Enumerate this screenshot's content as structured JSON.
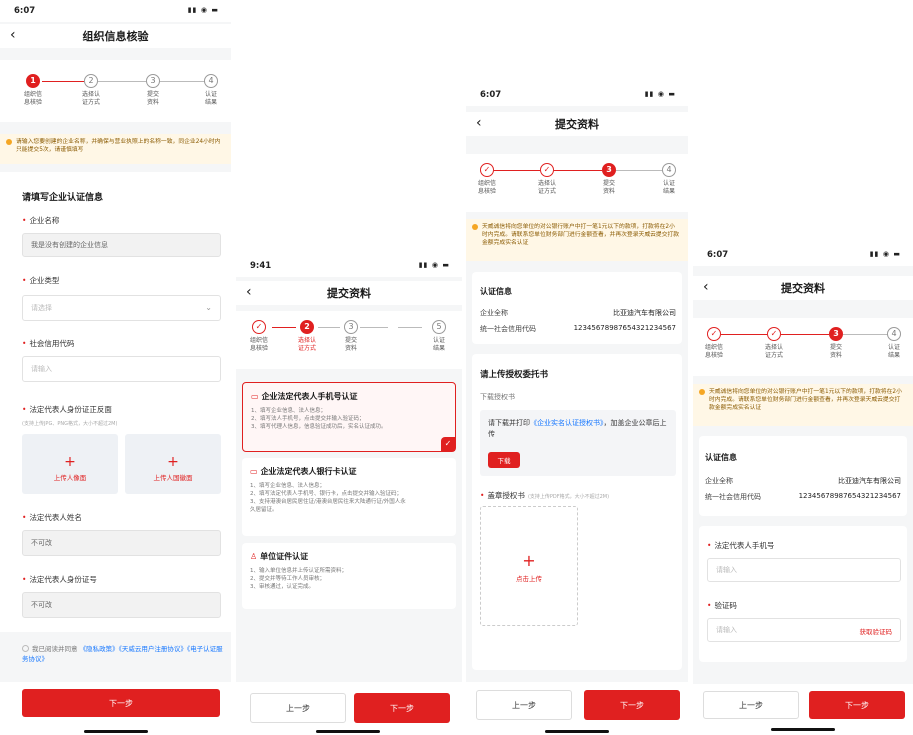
{
  "colors": {
    "accent": "#e02020",
    "notice_bg": "#fff7e6"
  },
  "screen1": {
    "status_time": "6:07",
    "title": "组织信息核验",
    "steps": [
      {
        "num": "1",
        "label1": "组织信",
        "label2": "息核验"
      },
      {
        "num": "2",
        "label1": "选择认",
        "label2": "证方式"
      },
      {
        "num": "3",
        "label1": "提交",
        "label2": "资料"
      },
      {
        "num": "4",
        "label1": "认证",
        "label2": "结果"
      }
    ],
    "notice": "请输入您要创建的企业名称，并确保与营业执照上的名称一致，同企业24小时内只能提交5次，请谨慎填写",
    "section_title": "请填写企业认证信息",
    "company_name_label": "企业名称",
    "company_name_value": "我是没有创建的企业信息",
    "company_type_label": "企业类型",
    "company_type_placeholder": "请选择",
    "credit_code_label": "社会信用代码",
    "credit_code_placeholder": "请输入",
    "id_card_label": "法定代表人身份证正反面",
    "id_card_hint": "(支持上传JPG、PNG格式，大小不超过2M)",
    "upload_front": "上传人像面",
    "upload_back": "上传人国徽面",
    "legal_name_label": "法定代表人姓名",
    "legal_name_value": "不可改",
    "legal_id_label": "法定代表人身份证号",
    "legal_id_value": "不可改",
    "agree_prefix": "我已阅读并同意",
    "agree_privacy": "《隐私政策》",
    "agree_terms": "《天威云用户注册协议》",
    "agree_esign": "《电子认证服务协议》",
    "next": "下一步"
  },
  "screen2": {
    "status_time": "9:41",
    "title": "提交资料",
    "steps": [
      {
        "num": "✓",
        "label1": "组织信",
        "label2": "息核验"
      },
      {
        "num": "2",
        "label1": "选择认",
        "label2": "证方式"
      },
      {
        "num": "3",
        "label1": "提交",
        "label2": "资料"
      },
      {
        "num": "5",
        "label1": "认证",
        "label2": "结果"
      }
    ],
    "opt1_title": "企业法定代表人手机号认证",
    "opt1_desc": [
      "1、填写企业信息、法人信息；",
      "2、填写法人手机号，点击提交并输入验证码；",
      "3、填写代理人信息，信息验证成功后，实名认证成功。"
    ],
    "opt2_title": "企业法定代表人银行卡认证",
    "opt2_desc": [
      "1、填写企业信息、法人信息；",
      "2、填写法定代表人手机号、银行卡，点击提交并输入验证码；",
      "3、支持港澳台居民居住证/港澳台居民往来大陆通行证/外国人永",
      "久居留证。"
    ],
    "opt3_title": "单位证件认证",
    "opt3_desc": [
      "1、输入单位信息并上传认证所需资料；",
      "2、提交并等待工作人员审核；",
      "3、审核通过，认证完成。"
    ],
    "prev": "上一步",
    "next": "下一步"
  },
  "screen3": {
    "status_time": "6:07",
    "title": "提交资料",
    "steps": [
      {
        "num": "✓",
        "label1": "组织信",
        "label2": "息核验"
      },
      {
        "num": "✓",
        "label1": "选择认",
        "label2": "证方式"
      },
      {
        "num": "3",
        "label1": "提交",
        "label2": "资料"
      },
      {
        "num": "4",
        "label1": "认证",
        "label2": "结果"
      }
    ],
    "notice": "天威诚信将向您单位的对公银行账户中打一笔1元以下的款项，打款将在2小时内完成。请联系您单位财务部门进行金额查看，并再次登录天威云提交打款金额完成实名认证",
    "info_title": "认证信息",
    "company_label": "企业全称",
    "company_value": "比亚迪汽车有限公司",
    "code_label": "统一社会信用代码",
    "code_value": "12345678987654321234567",
    "auth_title": "请上传授权委托书",
    "download_label": "下载授权书",
    "download_text1": "请下载并打印",
    "download_link": "《企业实名认证授权书》",
    "download_text2": "，加盖企业公章后上传",
    "download_btn": "下载",
    "stamp_label": "盖章授权书",
    "stamp_hint": "(支持上传PDF格式，大小不超过2M)",
    "upload_text": "点击上传",
    "prev": "上一步",
    "next": "下一步"
  },
  "screen4": {
    "status_time": "6:07",
    "title": "提交资料",
    "steps": [
      {
        "num": "✓",
        "label1": "组织信",
        "label2": "息核验"
      },
      {
        "num": "✓",
        "label1": "选择认",
        "label2": "证方式"
      },
      {
        "num": "3",
        "label1": "提交",
        "label2": "资料"
      },
      {
        "num": "4",
        "label1": "认证",
        "label2": "结果"
      }
    ],
    "notice": "天威诚信将向您单位的对公银行账户中打一笔1元以下的款项，打款将在2小时内完成。请联系您单位财务部门进行金额查看，并再次登录天威云提交打款金额完成实名认证",
    "info_title": "认证信息",
    "company_label": "企业全称",
    "company_value": "比亚迪汽车有限公司",
    "code_label": "统一社会信用代码",
    "code_value": "12345678987654321234567",
    "phone_label": "法定代表人手机号",
    "phone_placeholder": "请输入",
    "code_input_label": "验证码",
    "code_input_placeholder": "请输入",
    "get_code": "获取验证码",
    "prev": "上一步",
    "next": "下一步"
  }
}
